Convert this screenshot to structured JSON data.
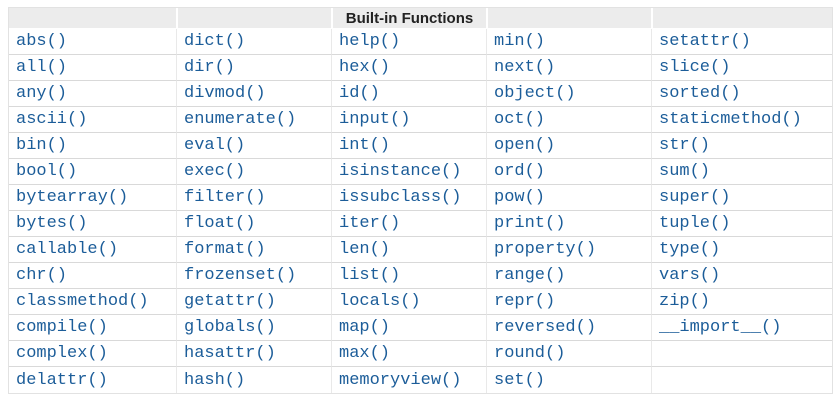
{
  "table": {
    "header": {
      "title": "Built-in Functions"
    },
    "colors": {
      "link_blue": "#1c5d99",
      "header_background": "#ececec",
      "header_text": "#222222",
      "row_border": "#d9d9d9",
      "column_border": "#e9e9e9",
      "outer_border": "#e2e2e2",
      "page_background": "#ffffff"
    },
    "columns": [
      [
        "abs()",
        "all()",
        "any()",
        "ascii()",
        "bin()",
        "bool()",
        "bytearray()",
        "bytes()",
        "callable()",
        "chr()",
        "classmethod()",
        "compile()",
        "complex()",
        "delattr()"
      ],
      [
        "dict()",
        "dir()",
        "divmod()",
        "enumerate()",
        "eval()",
        "exec()",
        "filter()",
        "float()",
        "format()",
        "frozenset()",
        "getattr()",
        "globals()",
        "hasattr()",
        "hash()"
      ],
      [
        "help()",
        "hex()",
        "id()",
        "input()",
        "int()",
        "isinstance()",
        "issubclass()",
        "iter()",
        "len()",
        "list()",
        "locals()",
        "map()",
        "max()",
        "memoryview()"
      ],
      [
        "min()",
        "next()",
        "object()",
        "oct()",
        "open()",
        "ord()",
        "pow()",
        "print()",
        "property()",
        "range()",
        "repr()",
        "reversed()",
        "round()",
        "set()"
      ],
      [
        "setattr()",
        "slice()",
        "sorted()",
        "staticmethod()",
        "str()",
        "sum()",
        "super()",
        "tuple()",
        "type()",
        "vars()",
        "zip()",
        "__import__()",
        "",
        ""
      ]
    ]
  }
}
